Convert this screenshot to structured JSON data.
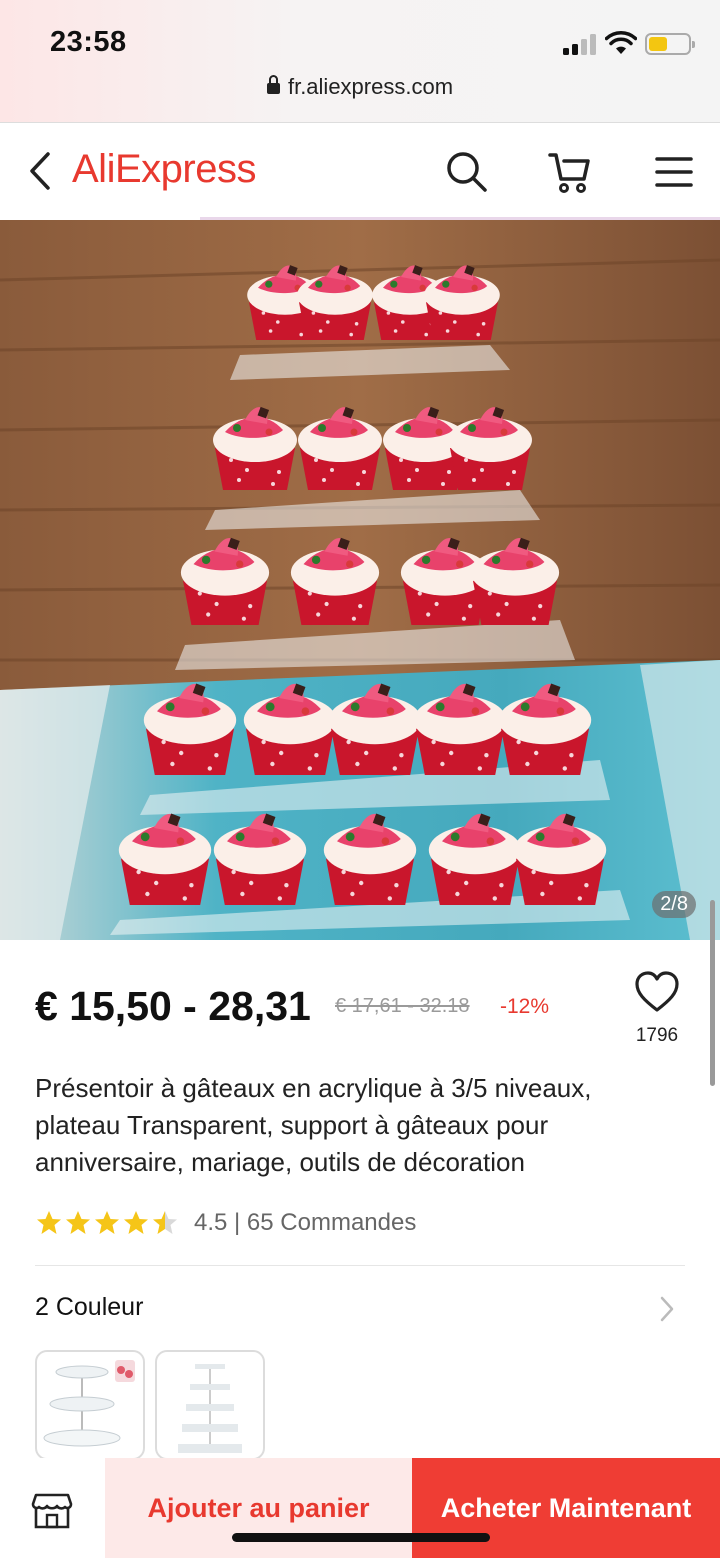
{
  "status_bar": {
    "time": "23:58",
    "url": "fr.aliexpress.com"
  },
  "header": {
    "logo_text": "AliExpress",
    "icons": [
      "back-chevron-icon",
      "search-icon",
      "cart-icon",
      "menu-icon"
    ]
  },
  "gallery": {
    "counter": "2/8"
  },
  "product": {
    "price": "€ 15,50 - 28,31",
    "old_price": "€ 17,61 - 32.18",
    "discount": "-12%",
    "wishlist_count": "1796",
    "title": "Présentoir à gâteaux en acrylique à 3/5 niveaux, plateau Transparent, support à gâteaux pour anniversaire, mariage, outils de décoration",
    "rating_stars": 4.5,
    "rating_text": "4.5 | 65 Commandes"
  },
  "variants": {
    "label": "2 Couleur",
    "options": [
      "3-tier round stand",
      "5-tier square stand"
    ]
  },
  "actions": {
    "store_icon": "store-icon",
    "add_to_cart": "Ajouter au panier",
    "buy_now": "Acheter Maintenant"
  },
  "colors": {
    "brand_red": "#e8392f",
    "buy_button": "#ef3d34",
    "cart_button_bg": "#fde9e8",
    "star": "#f5c518"
  }
}
